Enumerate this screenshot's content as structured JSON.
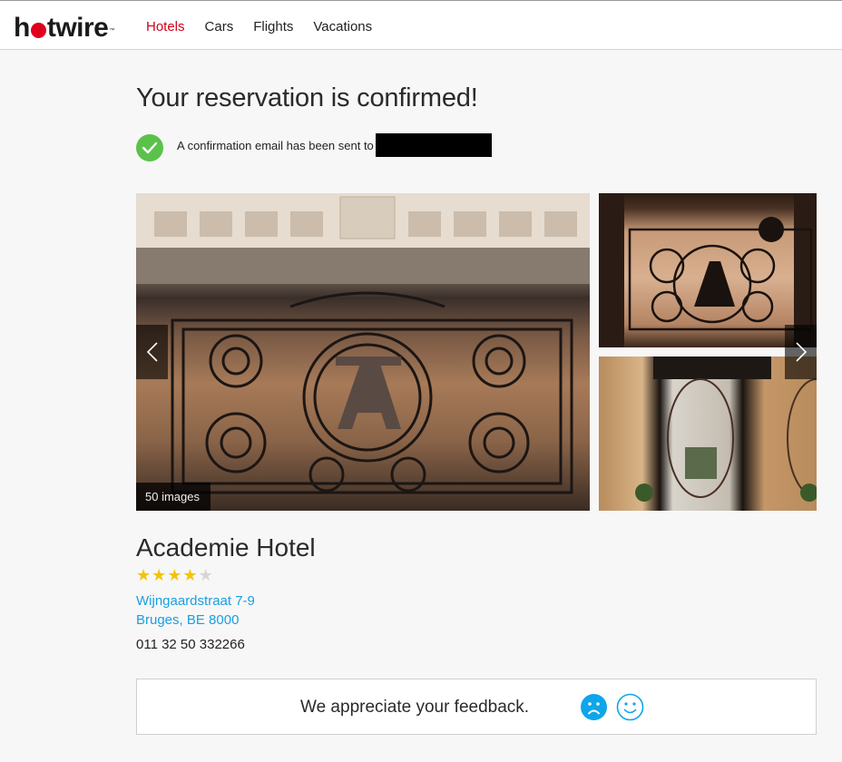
{
  "header": {
    "logo": {
      "pre": "h",
      "post": "twire",
      "tm": "™"
    },
    "nav": [
      {
        "label": "Hotels",
        "active": true
      },
      {
        "label": "Cars",
        "active": false
      },
      {
        "label": "Flights",
        "active": false
      },
      {
        "label": "Vacations",
        "active": false
      }
    ]
  },
  "confirmation": {
    "title": "Your reservation is confirmed!",
    "message": "A confirmation email has been sent to",
    "email_redacted": true
  },
  "gallery": {
    "image_count_label": "50 images",
    "prev_icon": "chevron-left-icon",
    "next_icon": "chevron-right-icon"
  },
  "hotel": {
    "name": "Academie Hotel",
    "rating": 4,
    "rating_max": 5,
    "address_line1": "Wijngaardstraat 7-9",
    "address_line2": "Bruges, BE 8000",
    "phone": "011 32 50 332266"
  },
  "feedback": {
    "prompt": "We appreciate your feedback.",
    "sad_icon": "sad-face-icon",
    "happy_icon": "happy-face-icon"
  },
  "colors": {
    "brand_red": "#e0001b",
    "nav_active": "#d0021b",
    "link_blue": "#1a9fe0",
    "check_green": "#5ac24a",
    "star_gold": "#f5c400",
    "feedback_blue": "#0ea5ea"
  }
}
